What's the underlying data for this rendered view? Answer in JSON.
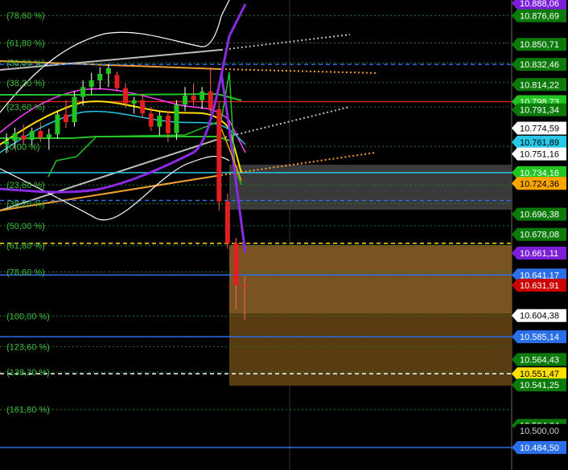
{
  "chart_data": {
    "type": "candlestick",
    "y_range": [
      10.4845,
      10.8881
    ],
    "fib_levels": [
      {
        "label": "(78,60 %)",
        "price": 10.877
      },
      {
        "label": "(61,80 %)",
        "price": 10.852
      },
      {
        "label": "(50,00 %)",
        "price": 10.834
      },
      {
        "label": "(38,20 %)",
        "price": 10.816
      },
      {
        "label": "(23,60 %)",
        "price": 10.794
      },
      {
        "label": "(0,00 %)",
        "price": 10.758
      },
      {
        "label": "(23,60 %)",
        "price": 10.723
      },
      {
        "label": "(38,20 %)",
        "price": 10.706
      },
      {
        "label": "(50,00 %)",
        "price": 10.686
      },
      {
        "label": "(61,80 %)",
        "price": 10.668
      },
      {
        "label": "(78,60 %)",
        "price": 10.644
      },
      {
        "label": "(100,00 %)",
        "price": 10.604
      },
      {
        "label": "(123,60 %)",
        "price": 10.576
      },
      {
        "label": "(138,20 %)",
        "price": 10.553
      },
      {
        "label": "(161,80 %)",
        "price": 10.519
      }
    ],
    "price_tags": [
      {
        "text": "10.888,06",
        "price": 10.8881,
        "bg": "#7a1fd6",
        "fg": "#ffffff"
      },
      {
        "text": "10.876,69",
        "price": 10.8767,
        "bg": "#0b7a0b",
        "fg": "#ffffff"
      },
      {
        "text": "10.850,71",
        "price": 10.8507,
        "bg": "#0b7a0b",
        "fg": "#ffffff"
      },
      {
        "text": "10.832,46",
        "price": 10.8325,
        "bg": "#0b7a0b",
        "fg": "#ffffff"
      },
      {
        "text": "10.814,22",
        "price": 10.8142,
        "bg": "#0b7a0b",
        "fg": "#ffffff"
      },
      {
        "text": "10.798,73",
        "price": 10.7987,
        "bg": "#22c422",
        "fg": "#ffffff"
      },
      {
        "text": "10.791,34",
        "price": 10.7913,
        "bg": "#0b7a0b",
        "fg": "#ffffff"
      },
      {
        "text": "10.774,59",
        "price": 10.7746,
        "bg": "#ffffff",
        "fg": "#000000"
      },
      {
        "text": "10.761,89",
        "price": 10.7619,
        "bg": "#29c8e8",
        "fg": "#000000"
      },
      {
        "text": "10.751,16",
        "price": 10.7512,
        "bg": "#ffffff",
        "fg": "#000000"
      },
      {
        "text": "10.734,16",
        "price": 10.7342,
        "bg": "#22c422",
        "fg": "#ffffff"
      },
      {
        "text": "10.724,36",
        "price": 10.7244,
        "bg": "#ffa500",
        "fg": "#000000"
      },
      {
        "text": "10.696,38",
        "price": 10.6964,
        "bg": "#0b7a0b",
        "fg": "#ffffff"
      },
      {
        "text": "10.678,08",
        "price": 10.6781,
        "bg": "#0b7a0b",
        "fg": "#ffffff"
      },
      {
        "text": "10.661,11",
        "price": 10.6611,
        "bg": "#7a1fd6",
        "fg": "#ffffff"
      },
      {
        "text": "10.641,17",
        "price": 10.6412,
        "bg": "#2a6ee8",
        "fg": "#ffffff"
      },
      {
        "text": "10.631,91",
        "price": 10.6319,
        "bg": "#cc0000",
        "fg": "#ffffff"
      },
      {
        "text": "10.604,38",
        "price": 10.6044,
        "bg": "#ffffff",
        "fg": "#000000"
      },
      {
        "text": "10.585,14",
        "price": 10.5851,
        "bg": "#2a6ee8",
        "fg": "#ffffff"
      },
      {
        "text": "10.564,43",
        "price": 10.5644,
        "bg": "#0b7a0b",
        "fg": "#ffffff"
      },
      {
        "text": "10.551,47",
        "price": 10.5515,
        "bg": "#ffe000",
        "fg": "#000000"
      },
      {
        "text": "10.541,25",
        "price": 10.5413,
        "bg": "#0b7a0b",
        "fg": "#ffffff"
      },
      {
        "text": "10.504,64",
        "price": 10.5046,
        "bg": "#0b7a0b",
        "fg": "#ffffff"
      },
      {
        "text": "10.500,00",
        "price": 10.5,
        "bg": "#000000",
        "fg": "#cfcfcf"
      },
      {
        "text": "10.484,50",
        "price": 10.4845,
        "bg": "#2a6ee8",
        "fg": "#ffffff"
      }
    ],
    "horizontal_lines": [
      {
        "price": 10.8325,
        "color": "#2a6ee8",
        "style": "dashed"
      },
      {
        "price": 10.7987,
        "color": "#d42020",
        "style": "solid"
      },
      {
        "price": 10.7342,
        "color": "#29c8e8",
        "style": "solid"
      },
      {
        "price": 10.7089,
        "color": "#2a6ee8",
        "style": "dashed"
      },
      {
        "price": 10.67,
        "color": "#ffe000",
        "style": "dashed"
      },
      {
        "price": 10.6412,
        "color": "#2a6ee8",
        "style": "solid"
      },
      {
        "price": 10.5851,
        "color": "#2a6ee8",
        "style": "solid"
      },
      {
        "price": 10.5515,
        "color": "#ffffff",
        "style": "dashed"
      },
      {
        "price": 10.4845,
        "color": "#2a6ee8",
        "style": "solid"
      }
    ],
    "last_price": 10.6319,
    "candles": [
      {
        "o": 10.76,
        "h": 10.77,
        "l": 10.752,
        "c": 10.763
      },
      {
        "o": 10.763,
        "h": 10.775,
        "l": 10.756,
        "c": 10.77
      },
      {
        "o": 10.768,
        "h": 10.778,
        "l": 10.76,
        "c": 10.764
      },
      {
        "o": 10.764,
        "h": 10.775,
        "l": 10.758,
        "c": 10.772
      },
      {
        "o": 10.772,
        "h": 10.78,
        "l": 10.762,
        "c": 10.766
      },
      {
        "o": 10.766,
        "h": 10.774,
        "l": 10.755,
        "c": 10.769
      },
      {
        "o": 10.769,
        "h": 10.79,
        "l": 10.765,
        "c": 10.787
      },
      {
        "o": 10.787,
        "h": 10.8,
        "l": 10.775,
        "c": 10.78
      },
      {
        "o": 10.78,
        "h": 10.808,
        "l": 10.776,
        "c": 10.803
      },
      {
        "o": 10.803,
        "h": 10.818,
        "l": 10.795,
        "c": 10.812
      },
      {
        "o": 10.812,
        "h": 10.825,
        "l": 10.805,
        "c": 10.818
      },
      {
        "o": 10.818,
        "h": 10.83,
        "l": 10.81,
        "c": 10.824
      },
      {
        "o": 10.824,
        "h": 10.833,
        "l": 10.812,
        "c": 10.829
      },
      {
        "o": 10.823,
        "h": 10.826,
        "l": 10.808,
        "c": 10.811
      },
      {
        "o": 10.811,
        "h": 10.815,
        "l": 10.793,
        "c": 10.797
      },
      {
        "o": 10.797,
        "h": 10.803,
        "l": 10.788,
        "c": 10.8
      },
      {
        "o": 10.8,
        "h": 10.806,
        "l": 10.784,
        "c": 10.788
      },
      {
        "o": 10.788,
        "h": 10.794,
        "l": 10.772,
        "c": 10.776
      },
      {
        "o": 10.776,
        "h": 10.79,
        "l": 10.768,
        "c": 10.786
      },
      {
        "o": 10.786,
        "h": 10.79,
        "l": 10.762,
        "c": 10.77
      },
      {
        "o": 10.77,
        "h": 10.8,
        "l": 10.764,
        "c": 10.796
      },
      {
        "o": 10.796,
        "h": 10.812,
        "l": 10.79,
        "c": 10.804
      },
      {
        "o": 10.804,
        "h": 10.815,
        "l": 10.795,
        "c": 10.8
      },
      {
        "o": 10.8,
        "h": 10.812,
        "l": 10.792,
        "c": 10.808
      },
      {
        "o": 10.808,
        "h": 10.83,
        "l": 10.788,
        "c": 10.792
      },
      {
        "o": 10.792,
        "h": 10.798,
        "l": 10.7,
        "c": 10.708
      },
      {
        "o": 10.708,
        "h": 10.715,
        "l": 10.665,
        "c": 10.67
      },
      {
        "o": 10.67,
        "h": 10.675,
        "l": 10.61,
        "c": 10.632
      },
      {
        "o": 10.632,
        "h": 10.64,
        "l": 10.6,
        "c": 10.631
      }
    ]
  }
}
